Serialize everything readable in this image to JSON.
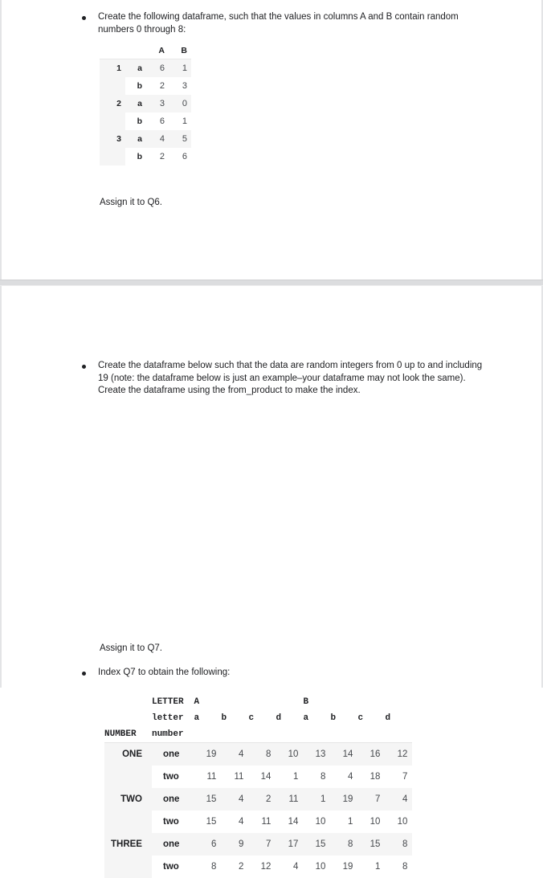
{
  "page_one": {
    "bullet_1": "Create the following dataframe, such that the values in columns A and B contain random numbers 0 through 8:",
    "assign_text": "Assign it to Q6.",
    "table_q6": {
      "columns": [
        "A",
        "B"
      ],
      "rows": [
        {
          "idx_outer": "1",
          "idx_inner": "a",
          "values": [
            "6",
            "1"
          ]
        },
        {
          "idx_outer": "",
          "idx_inner": "b",
          "values": [
            "2",
            "3"
          ]
        },
        {
          "idx_outer": "2",
          "idx_inner": "a",
          "values": [
            "3",
            "0"
          ]
        },
        {
          "idx_outer": "",
          "idx_inner": "b",
          "values": [
            "6",
            "1"
          ]
        },
        {
          "idx_outer": "3",
          "idx_inner": "a",
          "values": [
            "4",
            "5"
          ]
        },
        {
          "idx_outer": "",
          "idx_inner": "b",
          "values": [
            "2",
            "6"
          ]
        }
      ]
    }
  },
  "page_two": {
    "bullet_1": "Create the dataframe below such that the data are random integers from 0 up to and including 19 (note: the dataframe below is just an example–your dataframe may not look the same). Create the dataframe using the from_product to make the index.",
    "assign_text": "Assign it to Q7.",
    "bullet_2": "Index Q7 to obtain the following:",
    "table_q7": {
      "header_letter_label": "LETTER",
      "header_letter_sub_label": "letter",
      "header_number_label": "NUMBER",
      "header_number_sub_label": "number",
      "groups": [
        {
          "name": "A",
          "sub": [
            "a",
            "b",
            "c",
            "d"
          ]
        },
        {
          "name": "B",
          "sub": [
            "a",
            "b",
            "c",
            "d"
          ]
        }
      ],
      "rows": [
        {
          "idx_outer": "ONE",
          "idx_inner": "one",
          "values": [
            "19",
            "4",
            "8",
            "10",
            "13",
            "14",
            "16",
            "12"
          ]
        },
        {
          "idx_outer": "",
          "idx_inner": "two",
          "values": [
            "11",
            "11",
            "14",
            "1",
            "8",
            "4",
            "18",
            "7"
          ]
        },
        {
          "idx_outer": "TWO",
          "idx_inner": "one",
          "values": [
            "15",
            "4",
            "2",
            "11",
            "1",
            "19",
            "7",
            "4"
          ]
        },
        {
          "idx_outer": "",
          "idx_inner": "two",
          "values": [
            "15",
            "4",
            "11",
            "14",
            "10",
            "1",
            "10",
            "10"
          ]
        },
        {
          "idx_outer": "THREE",
          "idx_inner": "one",
          "values": [
            "6",
            "9",
            "7",
            "17",
            "15",
            "8",
            "15",
            "8"
          ]
        },
        {
          "idx_outer": "",
          "idx_inner": "two",
          "values": [
            "8",
            "2",
            "12",
            "4",
            "10",
            "19",
            "1",
            "8"
          ]
        }
      ]
    }
  }
}
